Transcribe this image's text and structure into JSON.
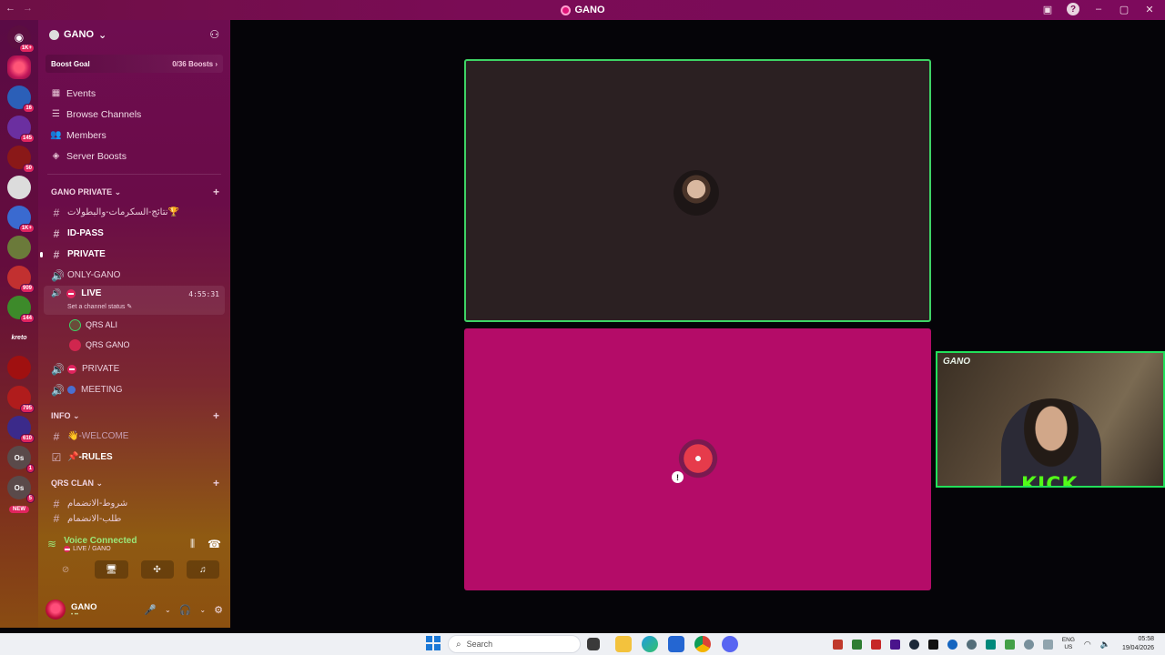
{
  "window": {
    "title": "GANO",
    "nav_back": "←",
    "nav_forward": "→"
  },
  "server": {
    "name": "GANO"
  },
  "boost": {
    "label": "Boost Goal",
    "progress": "0/36 Boosts",
    "chevron": "›"
  },
  "nav_items": [
    {
      "label": "Events",
      "icon": "calendar-icon"
    },
    {
      "label": "Browse Channels",
      "icon": "list-icon"
    },
    {
      "label": "Members",
      "icon": "members-icon"
    },
    {
      "label": "Server Boosts",
      "icon": "boost-icon"
    }
  ],
  "categories": {
    "private": "GANO PRIVATE",
    "info": "INFO",
    "qrs": "QRS CLAN"
  },
  "channels": {
    "results": "نتائج-السكرمات-والبطولات🏆",
    "id_pass": "ID-PASS",
    "private_text": "PRIVATE",
    "only_gano": "ONLY-GANO",
    "live": "LIVE",
    "live_time": "4:55:31",
    "live_status": "Set a channel status",
    "private_voice": "PRIVATE",
    "meeting": "MEETING",
    "welcome": "👋-WELCOME",
    "rules": "📌-RULES",
    "join_rules": "شروط-الانضمام",
    "join_request": "طلب-الانضمام"
  },
  "voice_users": [
    "QRS ALI",
    "QRS GANO"
  ],
  "server_badges": [
    "1K+",
    "16",
    "145",
    "50",
    "1K+",
    "",
    "909",
    "144",
    "",
    "",
    "795",
    "610",
    "1",
    "5"
  ],
  "server_labels": {
    "kreto": "kreto",
    "os1": "Os",
    "os2": "Os",
    "new": "NEW"
  },
  "voice_panel": {
    "status": "Voice Connected",
    "channel": "LIVE / GANO"
  },
  "user": {
    "name": "GANO",
    "sub": "• ••"
  },
  "stage": {
    "camera_label": "GANO",
    "camera_brand": "KICK"
  },
  "taskbar": {
    "search_placeholder": "Search",
    "lang_top": "ENG",
    "lang_bottom": "US",
    "time": "05:58",
    "date": "19/04/2026"
  },
  "colors": {
    "accent": "#e0245e",
    "speaking": "#3ed365",
    "stage_pink": "#b40c68",
    "kick_green": "#53fc18"
  }
}
